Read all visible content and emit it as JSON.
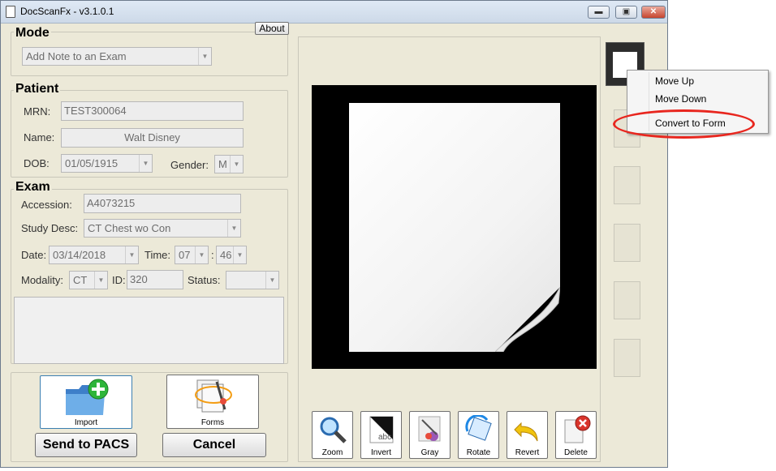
{
  "window": {
    "title": "DocScanFx  -  v3.1.0.1",
    "about_label": "About",
    "minimize_glyph": "▬",
    "maximize_glyph": "▣",
    "close_glyph": "✕"
  },
  "mode": {
    "title": "Mode",
    "selected": "Add Note to an Exam"
  },
  "patient": {
    "title": "Patient",
    "mrn_label": "MRN:",
    "mrn_value": "TEST300064",
    "name_label": "Name:",
    "name_value": "Walt Disney",
    "dob_label": "DOB:",
    "dob_value": "01/05/1915",
    "gender_label": "Gender:",
    "gender_value": "M"
  },
  "exam": {
    "title": "Exam",
    "accession_label": "Accession:",
    "accession_value": "A4073215",
    "study_label": "Study Desc:",
    "study_value": "CT Chest wo Con",
    "date_label": "Date:",
    "date_value": "03/14/2018",
    "time_label": "Time:",
    "hour_value": "07",
    "time_sep": ":",
    "minute_value": "46",
    "modality_label": "Modality:",
    "modality_value": "CT",
    "id_label": "ID:",
    "id_value": "320",
    "status_label": "Status:",
    "status_value": ""
  },
  "actions": {
    "import_label": "Import",
    "forms_label": "Forms",
    "send_label": "Send to PACS",
    "cancel_label": "Cancel"
  },
  "toolbar": [
    {
      "label": "Zoom",
      "icon": "zoom-icon"
    },
    {
      "label": "Invert",
      "icon": "invert-icon"
    },
    {
      "label": "Gray",
      "icon": "gray-icon"
    },
    {
      "label": "Rotate",
      "icon": "rotate-icon"
    },
    {
      "label": "Revert",
      "icon": "revert-icon"
    },
    {
      "label": "Delete",
      "icon": "delete-icon"
    }
  ],
  "context_menu": {
    "items": [
      "Move Up",
      "Move Down",
      "Convert to Form"
    ]
  },
  "colors": {
    "background": "#ece9d8",
    "canvas": "#000000",
    "highlight_ring": "#e8261e"
  }
}
